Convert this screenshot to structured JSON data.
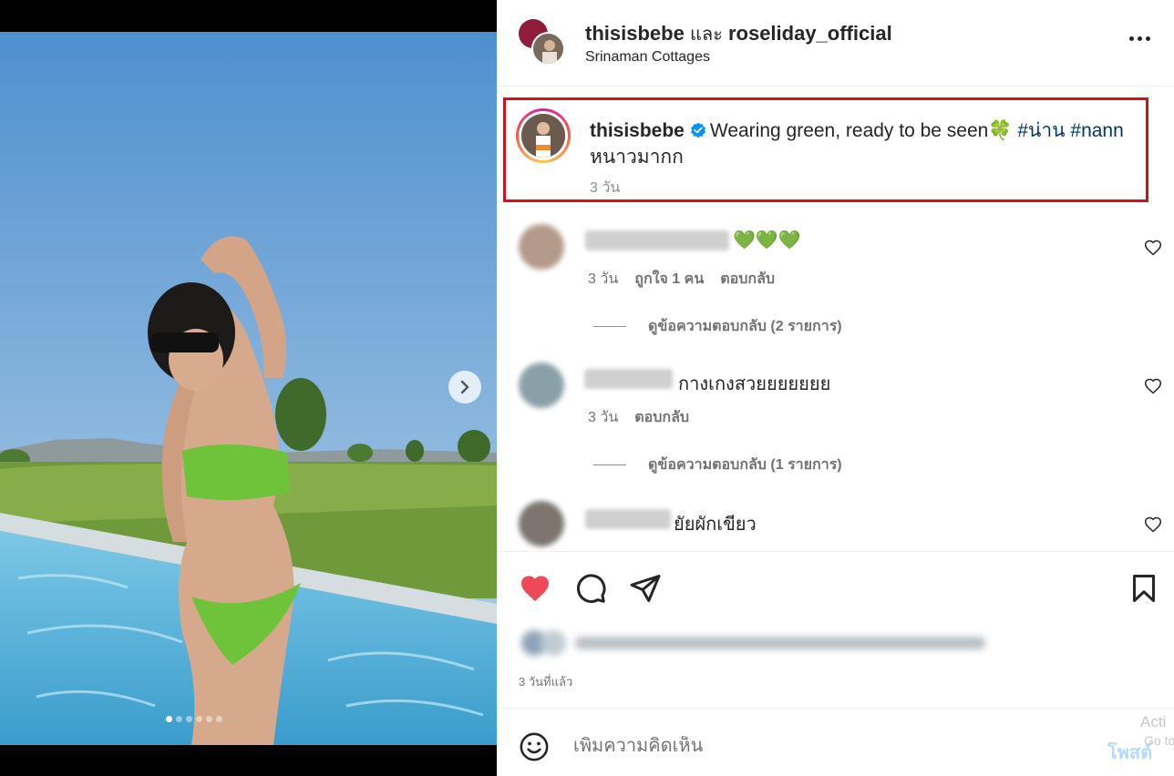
{
  "post": {
    "header": {
      "owner": "thisisbebe",
      "connector": "และ",
      "collaborator": "roseliday_official",
      "location": "Srinaman Cottages"
    },
    "caption": {
      "username": "thisisbebe",
      "text": "Wearing green, ready to be seen",
      "emoji": "🍀",
      "hashtags": [
        "#น่าน",
        "#nann"
      ],
      "line2": "หนาวมากก",
      "time": "3 วัน"
    },
    "comments": [
      {
        "username_blurred": "_____ __ _______",
        "text": "💚💚💚",
        "time": "3 วัน",
        "likes": "ถูกใจ 1 คน",
        "reply": "ตอบกลับ",
        "view_replies": "ดูข้อความตอบกลับ (2 รายการ)"
      },
      {
        "username_blurred": "__________",
        "text": "กางเกงสวยยยยยยย",
        "time": "3 วัน",
        "reply": "ตอบกลับ",
        "view_replies": "ดูข้อความตอบกลับ (1 รายการ)"
      },
      {
        "username_blurred": "_________",
        "text": "ยัยผักเขียว"
      }
    ],
    "post_time": "3 วันที่แล้ว",
    "liked": true,
    "carousel": {
      "count": 6,
      "active_index": 0
    }
  },
  "composer": {
    "placeholder": "เพิ่มความคิดเห็น",
    "post_label": "โพสต์"
  },
  "watermark": {
    "line1": "Acti",
    "line2": "Go to"
  },
  "colors": {
    "like_red": "#ed4956",
    "hashtag": "#00376b",
    "highlight_border": "#d6101a",
    "verified_blue": "#0095f6"
  }
}
